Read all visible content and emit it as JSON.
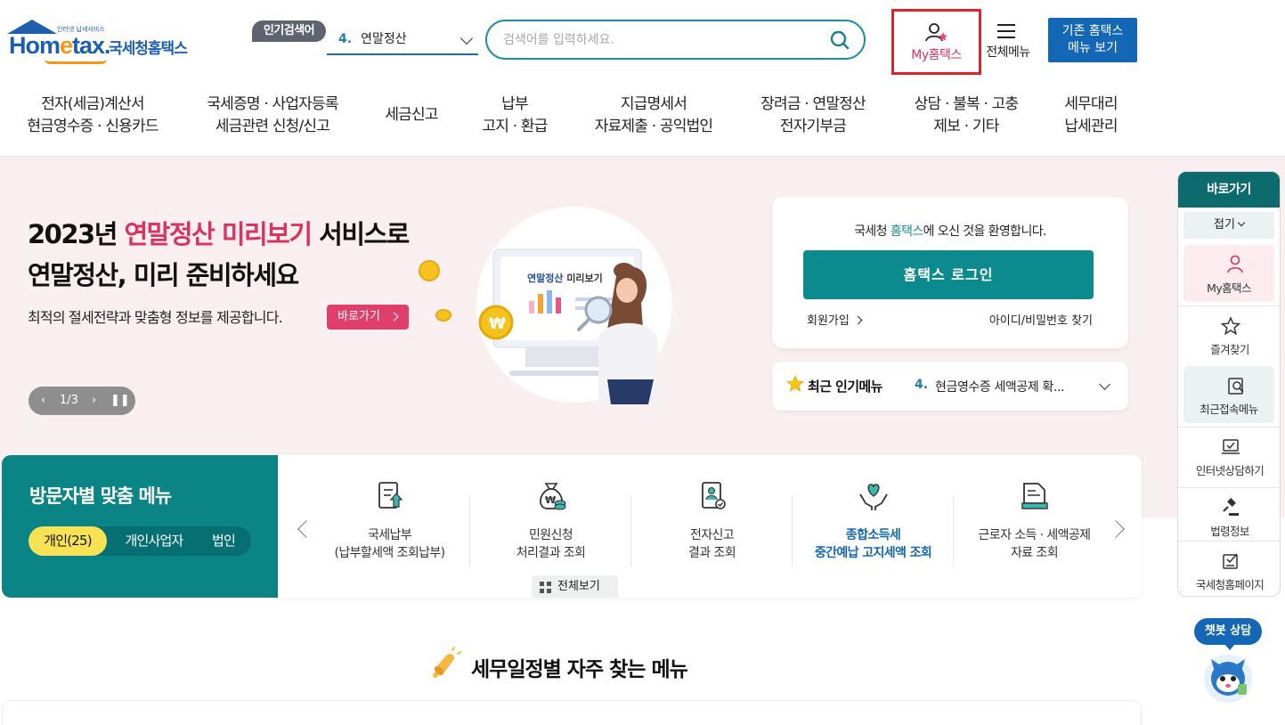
{
  "header": {
    "logo_sub": "인터넷 납세서비스",
    "logo_brand_a": "Hom",
    "logo_brand_e": "e",
    "logo_brand_b": "tax.",
    "logo_kr": "국세청홈택스",
    "popular_badge": "인기검색어",
    "popular_num": "4.",
    "popular_value": "연말정산",
    "search_placeholder": "검색어를 입력하세요.",
    "my_hometax": "My홈택스",
    "all_menu": "전체메뉴",
    "old_menu_line1": "기존 홈택스",
    "old_menu_line2": "메뉴 보기"
  },
  "gnb": [
    {
      "line1": "전자(세금)계산서",
      "line2": "현금영수증 · 신용카드"
    },
    {
      "line1": "국세증명 · 사업자등록",
      "line2": "세금관련 신청/신고"
    },
    {
      "line1": "세금신고",
      "line2": ""
    },
    {
      "line1": "납부",
      "line2": "고지 · 환급"
    },
    {
      "line1": "지급명세서",
      "line2": "자료제출 · 공익법인"
    },
    {
      "line1": "장려금 · 연말정산",
      "line2": "전자기부금"
    },
    {
      "line1": "상담 · 불복 · 고충",
      "line2": "제보 · 기타"
    },
    {
      "line1": "세무대리",
      "line2": "납세관리"
    }
  ],
  "hero": {
    "title_1a": "2023년 ",
    "title_1b": "연말정산 미리보기",
    "title_1c": " 서비스로",
    "title_2": "연말정산, 미리 준비하세요",
    "desc": "최적의 절세전략과 맞춤형 정보를 제공합니다.",
    "go_button": "바로가기",
    "pager": "1/3",
    "illust_label_a": "연말정산",
    "illust_label_b": " 미리보기",
    "coin_symbol": "₩"
  },
  "login": {
    "welcome_a": "국세청 ",
    "welcome_b": "홈택스",
    "welcome_c": "에 오신 것을 환영합니다.",
    "login_button": "홈택스 로그인",
    "join": "회원가입",
    "find": "아이디/비밀번호 찾기"
  },
  "recent_popular": {
    "title": "최근 인기메뉴",
    "num": "4.",
    "value": "현금영수증 세액공제 확..."
  },
  "visitor": {
    "title": "방문자별 맞춤 메뉴",
    "tabs": [
      "개인(25)",
      "개인사업자",
      "법인"
    ],
    "items": [
      {
        "line1": "국세납부",
        "line2": "(납부할세액 조회납부)",
        "icon": "tax-payment-icon"
      },
      {
        "line1": "민원신청",
        "line2": "처리결과 조회",
        "icon": "money-bag-icon"
      },
      {
        "line1": "전자신고",
        "line2": "결과 조회",
        "icon": "document-person-icon"
      },
      {
        "line1": "종합소득세",
        "line2": "중간예납 고지세액 조회",
        "icon": "heart-hands-icon"
      },
      {
        "line1": "근로자 소득 · 세액공제",
        "line2": "자료 조회",
        "icon": "form-stack-icon"
      }
    ],
    "view_all": "전체보기"
  },
  "section": {
    "title": "세무일정별 자주 찾는 메뉴"
  },
  "quick": {
    "title": "바로가기",
    "fold": "접기",
    "items": [
      {
        "label": "My홈택스",
        "icon": "user-icon"
      },
      {
        "label": "즐겨찾기",
        "icon": "star-icon"
      },
      {
        "label": "최근접속메뉴",
        "icon": "recent-search-icon"
      },
      {
        "label": "인터넷상담하기",
        "icon": "monitor-check-icon"
      },
      {
        "label": "법령정보",
        "icon": "gavel-icon"
      },
      {
        "label": "국세청홈페이지",
        "icon": "checklist-icon"
      }
    ]
  },
  "chatbot": {
    "label": "챗봇 상담"
  },
  "colors": {
    "brand_blue": "#1b5fae",
    "teal": "#0d8a8e",
    "pink": "#d8345f",
    "hero_bg": "#faeff0",
    "highlight_red": "#e0232a"
  }
}
